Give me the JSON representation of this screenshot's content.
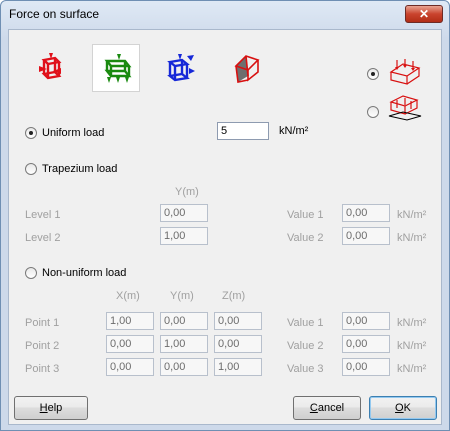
{
  "window": {
    "title": "Force on surface",
    "close_glyph": "✕"
  },
  "load_types": [
    {
      "icon": "red-surface-force-icon",
      "color": "#e0101a"
    },
    {
      "icon": "green-surface-force-icon",
      "color": "#1a8a10"
    },
    {
      "icon": "blue-surface-force-icon",
      "color": "#1628d8"
    },
    {
      "icon": "surface-prism-force-icon",
      "color": "#d81010"
    }
  ],
  "selected_load_type": 1,
  "uniform": {
    "label": "Uniform load",
    "value": "5",
    "unit": "kN/m²",
    "checked": true
  },
  "trapezium": {
    "label": "Trapezium load",
    "col_header": "Y(m)",
    "rows": [
      {
        "label": "Level 1",
        "y": "0,00",
        "value_label": "Value 1",
        "value": "0,00",
        "unit": "kN/m²"
      },
      {
        "label": "Level 2",
        "y": "1,00",
        "value_label": "Value 2",
        "value": "0,00",
        "unit": "kN/m²"
      }
    ]
  },
  "nonuniform": {
    "label": "Non-uniform load",
    "headers": [
      "X(m)",
      "Y(m)",
      "Z(m)"
    ],
    "rows": [
      {
        "label": "Point 1",
        "x": "1,00",
        "y": "0,00",
        "z": "0,00",
        "value_label": "Value 1",
        "value": "0,00",
        "unit": "kN/m²"
      },
      {
        "label": "Point 2",
        "x": "0,00",
        "y": "1,00",
        "z": "0,00",
        "value_label": "Value 2",
        "value": "0,00",
        "unit": "kN/m²"
      },
      {
        "label": "Point 3",
        "x": "0,00",
        "y": "0,00",
        "z": "1,00",
        "value_label": "Value 3",
        "value": "0,00",
        "unit": "kN/m²"
      }
    ]
  },
  "direction_options": [
    {
      "icon": "box-load-top-icon",
      "checked": true
    },
    {
      "icon": "box-load-bottom-icon",
      "checked": false
    }
  ],
  "buttons": {
    "help": {
      "prefix": "",
      "accel": "H",
      "rest": "elp"
    },
    "cancel": {
      "prefix": "",
      "accel": "C",
      "rest": "ancel"
    },
    "ok": {
      "prefix": "",
      "accel": "O",
      "rest": "K"
    }
  }
}
